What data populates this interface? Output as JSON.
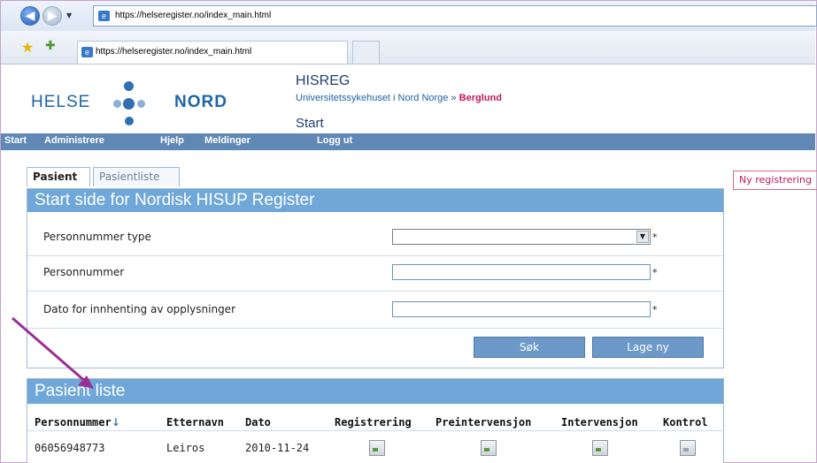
{
  "browser": {
    "url": "https://helseregister.no/index_main.html",
    "tab_title": "https://helseregister.no/index_main.html"
  },
  "logo": {
    "left": "HELSE",
    "right": "NORD"
  },
  "app": {
    "title": "HISREG",
    "org": "Universitetssykehuset i Nord Norge »",
    "user": "Berglund",
    "page": "Start"
  },
  "menu": [
    "Start",
    "Administrere",
    "Hjelp",
    "Meldinger",
    "Logg ut"
  ],
  "tabs": [
    "Pasient",
    "Pasientliste"
  ],
  "side_button": "Ny registrering",
  "form": {
    "title": "Start side for Nordisk HISUP Register",
    "fields": [
      {
        "label": "Personnummer type",
        "value": ""
      },
      {
        "label": "Personnummer",
        "value": ""
      },
      {
        "label": "Dato for innhenting av opplysninger",
        "value": ""
      }
    ],
    "required_mark": "*",
    "search_button": "Søk",
    "new_button": "Lage ny"
  },
  "patients": {
    "title": "Pasient liste",
    "sort_arrow": "↓",
    "columns": [
      "Personnummer",
      "Etternavn",
      "Dato",
      "Registrering",
      "Preintervensjon",
      "Intervensjon",
      "Kontrol"
    ],
    "rows": [
      {
        "personnummer": "06056948773",
        "etternavn": "Leiros",
        "dato": "2010-11-24"
      }
    ]
  },
  "colors": {
    "accent": "#6fa7d8",
    "menubar": "#5f88b5",
    "highlight": "#c2185b",
    "annotation_arrow": "#9b2f94"
  }
}
